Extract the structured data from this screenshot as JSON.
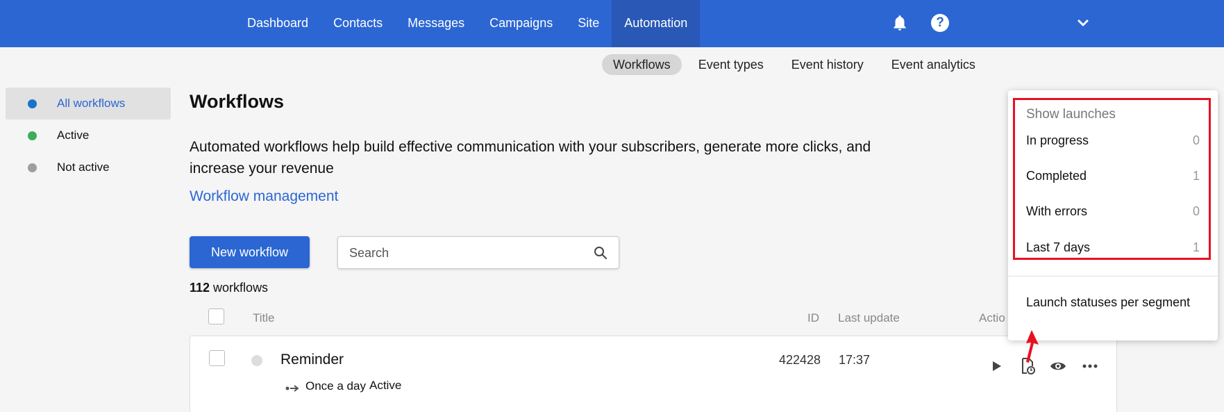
{
  "topnav": {
    "items": [
      {
        "label": "Dashboard"
      },
      {
        "label": "Contacts"
      },
      {
        "label": "Messages"
      },
      {
        "label": "Campaigns"
      },
      {
        "label": "Site"
      },
      {
        "label": "Automation"
      }
    ],
    "active": "Automation",
    "icons": [
      "bell-icon",
      "help-icon",
      "chevron-down-icon"
    ],
    "help_glyph": "?"
  },
  "subnav": {
    "items": [
      {
        "label": "Workflows"
      },
      {
        "label": "Event types"
      },
      {
        "label": "Event history"
      },
      {
        "label": "Event analytics"
      }
    ],
    "active": "Workflows"
  },
  "sidebar": {
    "items": [
      {
        "label": "All workflows",
        "dot_color": "#1a73c9"
      },
      {
        "label": "Active",
        "dot_color": "#3cae5a"
      },
      {
        "label": "Not active",
        "dot_color": "#9e9e9e"
      }
    ],
    "active": "All workflows"
  },
  "main": {
    "title": "Workflows",
    "description": "Automated workflows help build effective communication with your subscribers, generate more clicks, and increase your revenue",
    "management_link": "Workflow management",
    "new_button": "New workflow",
    "search_placeholder": "Search",
    "count_number": "112",
    "count_suffix": " workflows"
  },
  "table": {
    "headers": {
      "title": "Title",
      "id": "ID",
      "last_update": "Last update",
      "actions": "Actio"
    },
    "rows": [
      {
        "title": "Reminder",
        "id": "422428",
        "last_update": "17:37",
        "schedule": "Once a day",
        "status": "Active",
        "actions": [
          "play-icon",
          "launch-history-icon",
          "eye-icon",
          "more-icon"
        ]
      }
    ]
  },
  "launches_dropdown": {
    "header": "Show launches",
    "items": [
      {
        "label": "In progress",
        "count": "0"
      },
      {
        "label": "Completed",
        "count": "1"
      },
      {
        "label": "With errors",
        "count": "0"
      },
      {
        "label": "Last 7 days",
        "count": "1"
      }
    ],
    "footer_link": "Launch statuses per segment"
  },
  "colors": {
    "accent": "#2b66d3",
    "highlight": "#e81123"
  }
}
